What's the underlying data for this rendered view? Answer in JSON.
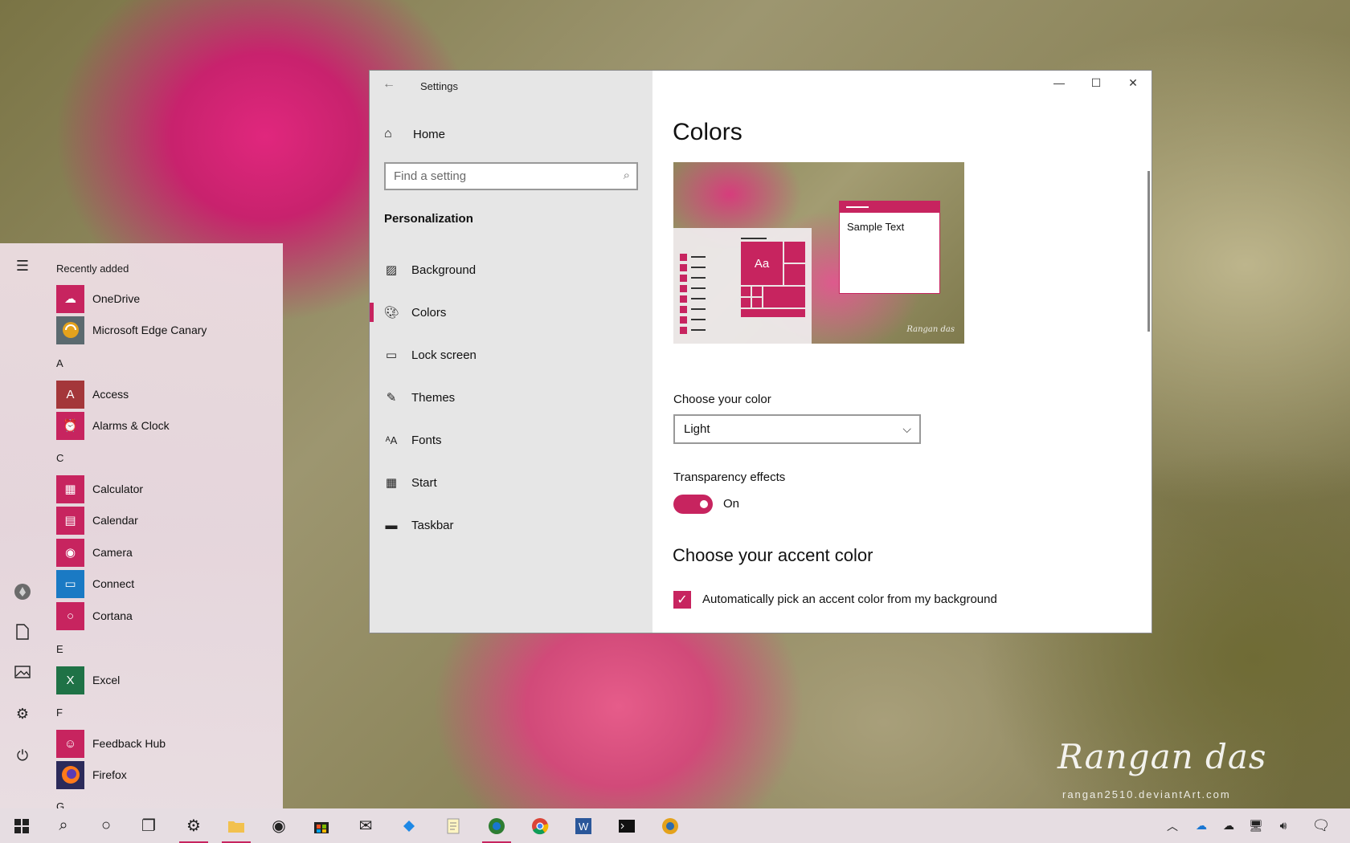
{
  "watermark": {
    "name": "Rangan das",
    "site": "rangan2510.deviantArt.com"
  },
  "start_menu": {
    "rail_icons": [
      "hamburger-icon",
      "user-avatar-icon",
      "documents-icon",
      "pictures-icon",
      "settings-icon",
      "power-icon"
    ],
    "groups": [
      {
        "header": "Recently added",
        "apps": [
          {
            "name": "OneDrive",
            "icon": "onedrive-icon"
          },
          {
            "name": "Microsoft Edge Canary",
            "icon": "edge-canary-icon"
          }
        ]
      },
      {
        "header": "A",
        "apps": [
          {
            "name": "Access",
            "icon": "access-icon"
          },
          {
            "name": "Alarms & Clock",
            "icon": "alarm-clock-icon"
          }
        ]
      },
      {
        "header": "C",
        "apps": [
          {
            "name": "Calculator",
            "icon": "calculator-icon"
          },
          {
            "name": "Calendar",
            "icon": "calendar-icon"
          },
          {
            "name": "Camera",
            "icon": "camera-icon"
          },
          {
            "name": "Connect",
            "icon": "connect-icon"
          },
          {
            "name": "Cortana",
            "icon": "cortana-icon"
          }
        ]
      },
      {
        "header": "E",
        "apps": [
          {
            "name": "Excel",
            "icon": "excel-icon"
          }
        ]
      },
      {
        "header": "F",
        "apps": [
          {
            "name": "Feedback Hub",
            "icon": "feedback-hub-icon"
          },
          {
            "name": "Firefox",
            "icon": "firefox-icon"
          }
        ]
      },
      {
        "header": "G",
        "apps": []
      }
    ]
  },
  "settings": {
    "window_title": "Settings",
    "home_label": "Home",
    "search_placeholder": "Find a setting",
    "section_title": "Personalization",
    "nav_items": [
      {
        "label": "Background",
        "icon": "picture-icon"
      },
      {
        "label": "Colors",
        "icon": "palette-icon",
        "active": true
      },
      {
        "label": "Lock screen",
        "icon": "lock-screen-icon"
      },
      {
        "label": "Themes",
        "icon": "brush-icon"
      },
      {
        "label": "Fonts",
        "icon": "fonts-icon"
      },
      {
        "label": "Start",
        "icon": "start-icon"
      },
      {
        "label": "Taskbar",
        "icon": "taskbar-icon"
      }
    ],
    "page_title": "Colors",
    "preview_sample_text": "Sample Text",
    "preview_tile_text": "Aa",
    "choose_color_label": "Choose your color",
    "choose_color_value": "Light",
    "transparency_label": "Transparency effects",
    "transparency_state": "On",
    "accent_heading": "Choose your accent color",
    "auto_accent_label": "Automatically pick an accent color from my background",
    "auto_accent_checked": true
  },
  "taskbar": {
    "items": [
      "windows-start-icon",
      "search-icon",
      "cortana-circle-icon",
      "task-view-icon",
      "settings-icon",
      "file-explorer-icon",
      "camera-icon",
      "store-icon",
      "mail-icon",
      "visual-studio-icon",
      "notepad-icon",
      "edge-dev-icon",
      "chrome-icon",
      "word-icon",
      "terminal-icon",
      "edge-canary-icon"
    ],
    "active": [
      "settings-icon",
      "file-explorer-icon",
      "edge-dev-icon"
    ],
    "tray": [
      "chevron-up-icon",
      "onedrive-blue-icon",
      "onedrive-cloud-icon",
      "network-icon",
      "volume-icon",
      "action-center-icon"
    ]
  },
  "colors": {
    "accent": "#c7245f"
  }
}
